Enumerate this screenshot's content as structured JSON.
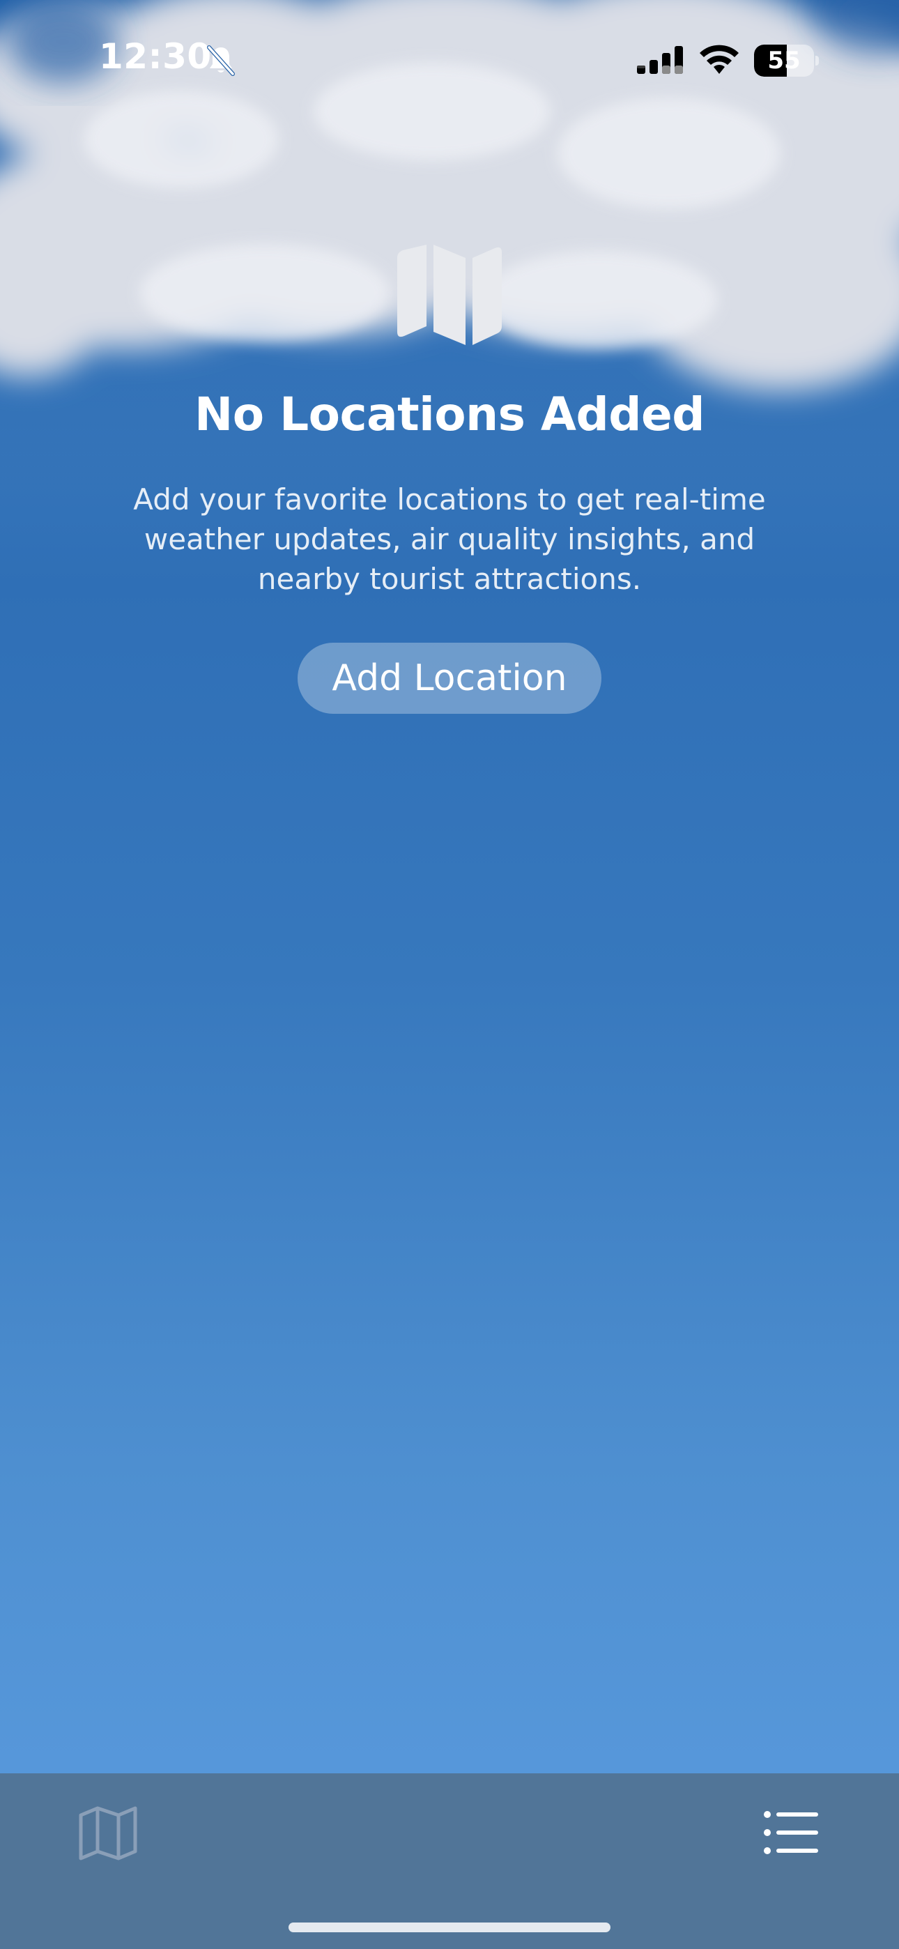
{
  "status_bar": {
    "time": "12:30",
    "battery_level": "55",
    "battery_fraction": 0.55
  },
  "empty_state": {
    "icon": "map-icon",
    "title": "No Locations Added",
    "description": "Add your favorite locations to get real-time weather updates, air quality insights, and nearby tourist attractions.",
    "button_label": "Add Location"
  },
  "tab_bar": {
    "left_icon": "map-icon",
    "right_icon": "list-icon"
  },
  "colors": {
    "sky_top": "#1f5fa8",
    "sky_bottom": "#5b9ce0",
    "tab_bar": "#517598",
    "text": "#ffffff"
  }
}
